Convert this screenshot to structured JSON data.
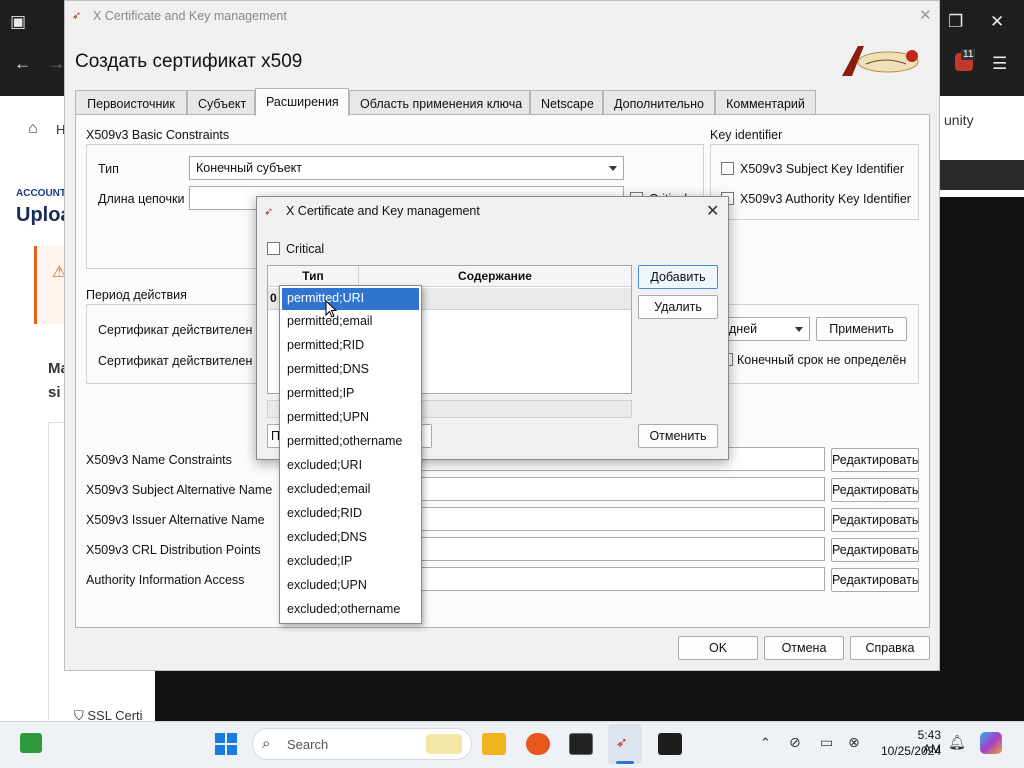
{
  "browser": {
    "fragments": [
      "H",
      "ACCOUNT",
      "Uploa",
      "Ma",
      "si",
      "SSL Certi",
      "unity"
    ],
    "tab_count_badge": "11"
  },
  "main_window": {
    "title": "X Certificate and Key management",
    "heading": "Создать сертификат x509",
    "tabs": [
      "Первоисточник",
      "Субъект",
      "Расширения",
      "Область применения ключа",
      "Netscape",
      "Дополнительно",
      "Комментарий"
    ],
    "active_tab": "Расширения",
    "basic_constraints": {
      "title": "X509v3 Basic Constraints",
      "type_label": "Тип",
      "type_value": "Конечный субъект",
      "chain_label": "Длина цепочки",
      "critical_label": "Critical"
    },
    "key_identifier": {
      "title": "Key identifier",
      "subject_key": "X509v3 Subject Key Identifier",
      "authority_key": "X509v3 Authority Key Identifier"
    },
    "validity": {
      "title": "Период действия",
      "from_label": "Сертификат действителен с",
      "to_label": "Сертификат действителен по",
      "unit_value": "дней",
      "apply_button": "Применить",
      "no_expiry_label": "Конечный срок не определён"
    },
    "extensions": [
      {
        "label": "X509v3 Name Constraints",
        "button": "Редактировать"
      },
      {
        "label": "X509v3 Subject Alternative Name",
        "button": "Редактировать"
      },
      {
        "label": "X509v3 Issuer Alternative Name",
        "button": "Редактировать"
      },
      {
        "label": "X509v3 CRL Distribution Points",
        "button": "Редактировать"
      },
      {
        "label": "Authority Information Access",
        "button": "Редактировать"
      }
    ],
    "buttons": {
      "ok": "OK",
      "cancel": "Отмена",
      "help": "Справка"
    }
  },
  "dialog": {
    "title": "X Certificate and Key management",
    "critical_label": "Critical",
    "columns": [
      "Тип",
      "Содержание"
    ],
    "row_index": "0",
    "add_button": "Добавить",
    "remove_button": "Удалить",
    "cancel_button": "Отменить",
    "bottom_left_button": "П"
  },
  "dropdown": {
    "items": [
      "permitted;URI",
      "permitted;email",
      "permitted;RID",
      "permitted;DNS",
      "permitted;IP",
      "permitted;UPN",
      "permitted;othername",
      "excluded;URI",
      "excluded;email",
      "excluded;RID",
      "excluded;DNS",
      "excluded;IP",
      "excluded;UPN",
      "excluded;othername"
    ],
    "selected": "permitted;URI"
  },
  "taskbar": {
    "search_placeholder": "Search",
    "time": "5:43 AM",
    "date": "10/25/2024"
  },
  "colors": {
    "accent": "#2f74d0",
    "dark": "#1f1f1f",
    "taskbar": "#eef1f6"
  }
}
